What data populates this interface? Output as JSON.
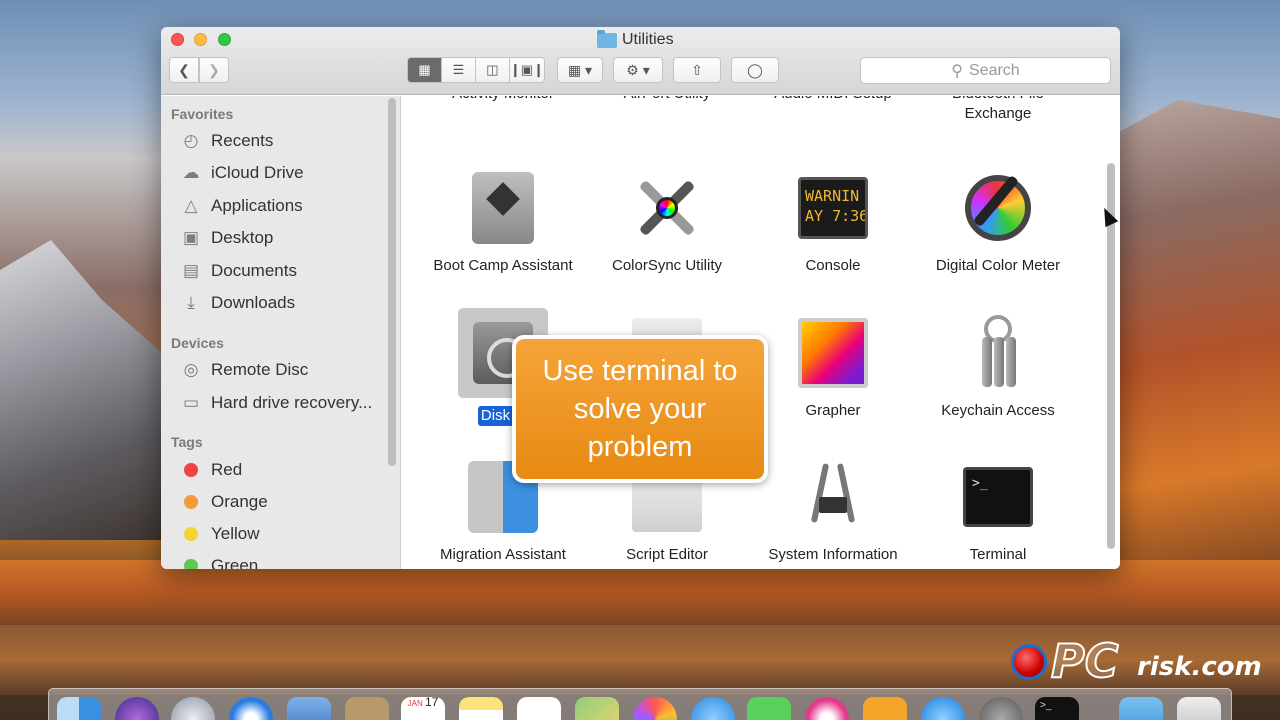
{
  "window": {
    "title": "Utilities",
    "search_placeholder": "Search"
  },
  "toolbar": {
    "back_icon": "chevron-left-icon",
    "forward_icon": "chevron-right-icon",
    "views": [
      "icon-view",
      "list-view",
      "column-view",
      "gallery-view"
    ],
    "active_view": "icon-view",
    "arrange_icon": "grid-arrange-icon",
    "action_icon": "gear-icon",
    "share_icon": "share-icon",
    "tag_icon": "tag-icon"
  },
  "sidebar": {
    "favorites_heading": "Favorites",
    "favorites": [
      {
        "label": "Recents",
        "icon": "clock-icon"
      },
      {
        "label": "iCloud Drive",
        "icon": "cloud-icon"
      },
      {
        "label": "Applications",
        "icon": "applications-icon"
      },
      {
        "label": "Desktop",
        "icon": "desktop-icon"
      },
      {
        "label": "Documents",
        "icon": "document-icon"
      },
      {
        "label": "Downloads",
        "icon": "download-icon"
      }
    ],
    "devices_heading": "Devices",
    "devices": [
      {
        "label": "Remote Disc",
        "icon": "disc-icon"
      },
      {
        "label": "Hard drive recovery...",
        "icon": "drive-icon"
      }
    ],
    "tags_heading": "Tags",
    "tags": [
      {
        "label": "Red",
        "color": "#ee4444"
      },
      {
        "label": "Orange",
        "color": "#f59a3a"
      },
      {
        "label": "Yellow",
        "color": "#f5d431"
      },
      {
        "label": "Green",
        "color": "#5ec94f"
      }
    ]
  },
  "content": {
    "partial_row": [
      "Activity Monitor",
      "AirPort Utility",
      "Audio MIDI Setup",
      "Bluetooth File Exchange"
    ],
    "apps": [
      {
        "label": "Boot Camp Assistant"
      },
      {
        "label": "ColorSync Utility"
      },
      {
        "label": "Console",
        "screen_line1": "WARNIN",
        "screen_line2": "AY 7:36"
      },
      {
        "label": "Digital Color Meter"
      },
      {
        "label": "Disk Utility",
        "visible_label": "Disk U",
        "selected": true
      },
      {
        "label": "Grapher"
      },
      {
        "label": "Keychain Access"
      },
      {
        "label": "Migration Assistant"
      },
      {
        "label": "Script Editor"
      },
      {
        "label": "System Information"
      },
      {
        "label": "Terminal",
        "screen_line1": ">_"
      }
    ]
  },
  "callout": {
    "text": "Use terminal to solve your problem",
    "color": "#e98f1a"
  },
  "watermark": {
    "text_pc": "PC",
    "text_risk": "risk.com"
  },
  "dock": {
    "calendar_month": "JAN",
    "calendar_day": "17"
  }
}
